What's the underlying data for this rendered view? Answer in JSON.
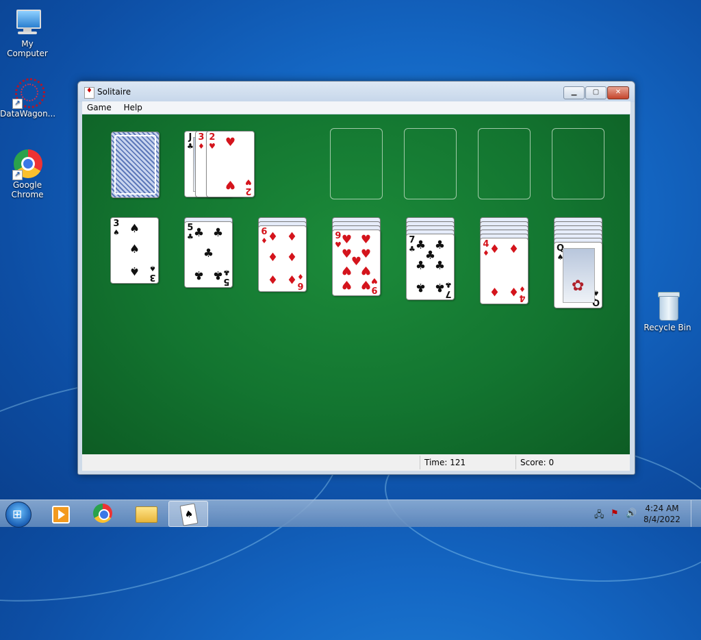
{
  "desktop": {
    "icons": [
      {
        "label": "My Computer"
      },
      {
        "label": "DataWagon..."
      },
      {
        "label": "Google Chrome"
      },
      {
        "label": "Recycle Bin"
      }
    ]
  },
  "window": {
    "title": "Solitaire",
    "controls": {
      "minimize": "▁",
      "maximize": "▢",
      "close": "✕"
    },
    "menu": [
      "Game",
      "Help"
    ],
    "status": {
      "time_label": "Time:",
      "time_value": "121",
      "score_label": "Score:",
      "score_value": "0"
    }
  },
  "game": {
    "stock": {
      "face_down": true
    },
    "waste": [
      {
        "rank": "J",
        "suit": "♣",
        "color": "black"
      },
      {
        "rank": "3",
        "suit": "♦",
        "color": "red"
      },
      {
        "rank": "2",
        "suit": "♥",
        "color": "red"
      }
    ],
    "foundations": [
      {
        "empty": true
      },
      {
        "empty": true
      },
      {
        "empty": true
      },
      {
        "empty": true
      }
    ],
    "tableau": [
      {
        "hidden": 0,
        "top": {
          "rank": "3",
          "suit": "♠",
          "color": "black"
        }
      },
      {
        "hidden": 1,
        "top": {
          "rank": "5",
          "suit": "♣",
          "color": "black"
        }
      },
      {
        "hidden": 2,
        "top": {
          "rank": "6",
          "suit": "♦",
          "color": "red"
        }
      },
      {
        "hidden": 3,
        "top": {
          "rank": "9",
          "suit": "♥",
          "color": "red"
        }
      },
      {
        "hidden": 4,
        "top": {
          "rank": "7",
          "suit": "♣",
          "color": "black"
        }
      },
      {
        "hidden": 5,
        "top": {
          "rank": "4",
          "suit": "♦",
          "color": "red"
        }
      },
      {
        "hidden": 6,
        "top": {
          "rank": "Q",
          "suit": "♠",
          "color": "black"
        }
      }
    ]
  },
  "taskbar": {
    "apps": [
      {
        "icon": "media-player-icon"
      },
      {
        "icon": "chrome-icon"
      },
      {
        "icon": "file-explorer-icon"
      },
      {
        "icon": "solitaire-icon",
        "active": true
      }
    ],
    "tray": {
      "icons": [
        "network-icon",
        "action-center-flag-icon",
        "volume-icon"
      ]
    },
    "clock": {
      "time": "4:24 AM",
      "date": "8/4/2022"
    }
  },
  "colors": {
    "felt": "#137530",
    "red_suit": "#d4141c",
    "black_suit": "#111111"
  }
}
